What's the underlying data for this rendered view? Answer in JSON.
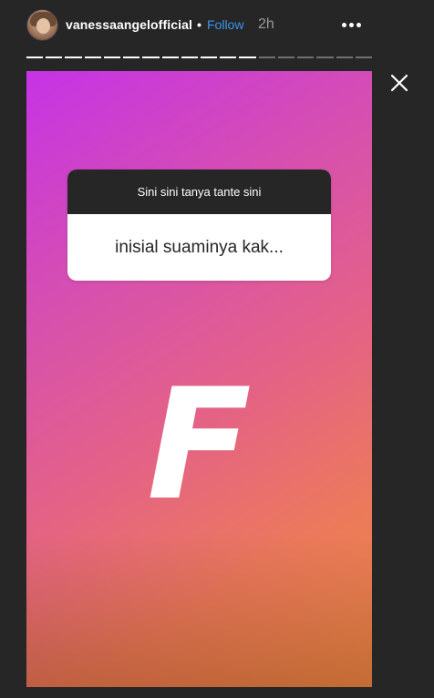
{
  "header": {
    "username": "vanessaangelofficial",
    "separator": "•",
    "follow_label": "Follow",
    "time": "2h",
    "more_icon": "more-horizontal-icon",
    "close_icon": "close-icon"
  },
  "progress": {
    "total_segments": 18,
    "completed_segments": 12
  },
  "story": {
    "question_prompt": "Sini sini tanya tante sini",
    "question_answer": "inisial suaminya kak...",
    "big_text": "F",
    "colors": {
      "gradient_start": "#c633e6",
      "gradient_mid": "#e46286",
      "gradient_end": "#f08a48"
    }
  }
}
